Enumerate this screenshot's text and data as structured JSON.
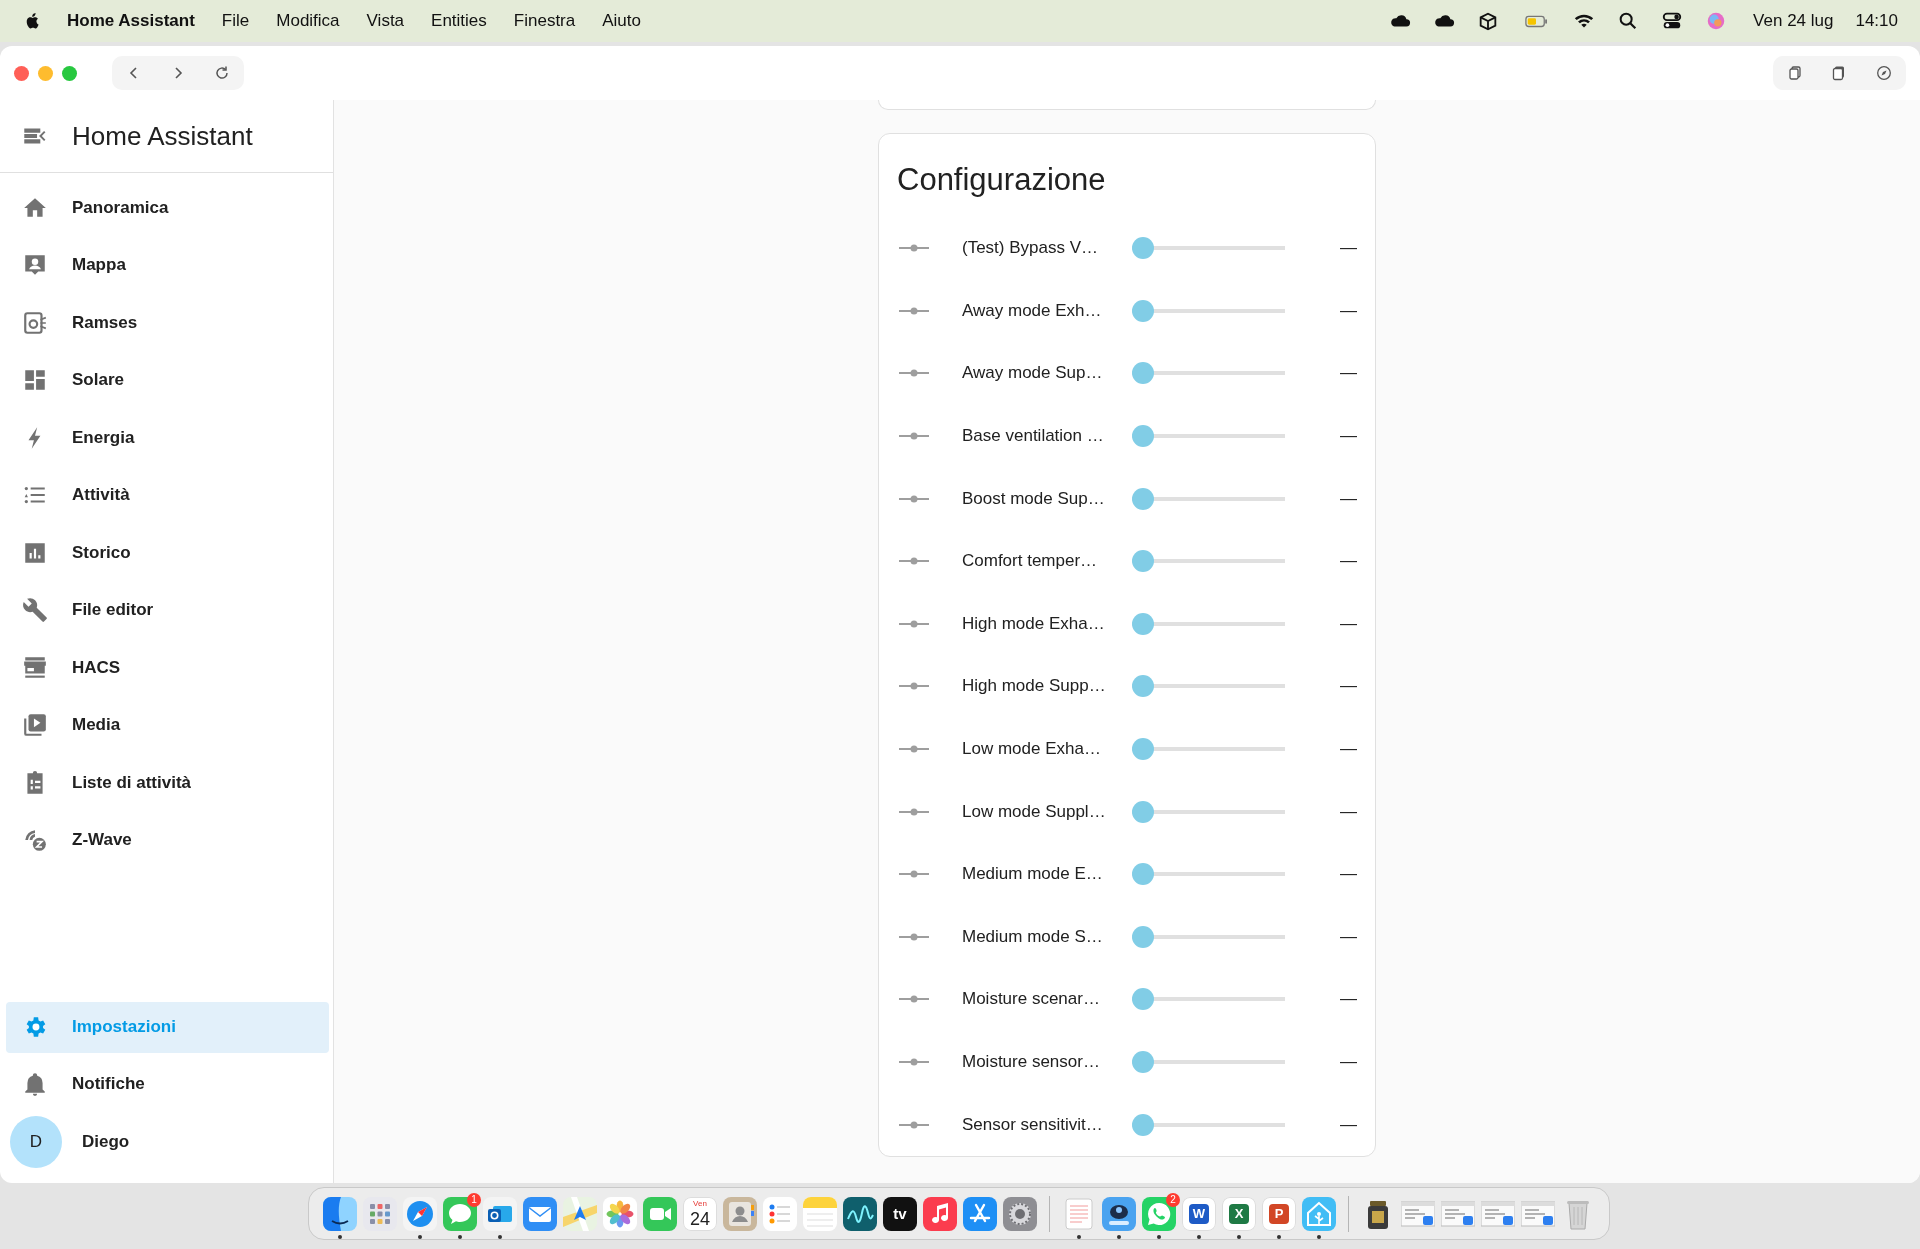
{
  "menu_bar": {
    "app_name": "Home Assistant",
    "menus": [
      "File",
      "Modifica",
      "Vista",
      "Entities",
      "Finestra",
      "Aiuto"
    ],
    "date": "Ven 24 lug",
    "time": "14:10"
  },
  "sidebar": {
    "title": "Home Assistant",
    "items": [
      {
        "label": "Panoramica",
        "kind": "home",
        "selected": false
      },
      {
        "label": "Mappa",
        "kind": "map",
        "selected": false
      },
      {
        "label": "Ramses",
        "kind": "device",
        "selected": false
      },
      {
        "label": "Solare",
        "kind": "dashboard",
        "selected": false
      },
      {
        "label": "Energia",
        "kind": "energy",
        "selected": false
      },
      {
        "label": "Attività",
        "kind": "logbook",
        "selected": false
      },
      {
        "label": "Storico",
        "kind": "history",
        "selected": false
      },
      {
        "label": "File editor",
        "kind": "editor",
        "selected": false
      },
      {
        "label": "HACS",
        "kind": "store",
        "selected": false
      },
      {
        "label": "Media",
        "kind": "media",
        "selected": false
      },
      {
        "label": "Liste di attività",
        "kind": "todo",
        "selected": false
      },
      {
        "label": "Z-Wave",
        "kind": "zwave",
        "selected": false
      }
    ],
    "bottom_items": [
      {
        "label": "Impostazioni",
        "kind": "settings",
        "selected": true
      },
      {
        "label": "Notifiche",
        "kind": "notifications",
        "selected": false
      }
    ],
    "user": {
      "initial": "D",
      "name": "Diego"
    }
  },
  "card": {
    "title": "Configurazione",
    "rows": [
      {
        "name": "(Test) Bypass V…",
        "level": 0,
        "value": "—"
      },
      {
        "name": "Away mode Exh…",
        "level": 0,
        "value": "—"
      },
      {
        "name": "Away mode Sup…",
        "level": 0,
        "value": "—"
      },
      {
        "name": "Base ventilation …",
        "level": 0,
        "value": "—"
      },
      {
        "name": "Boost mode Sup…",
        "level": 0,
        "value": "—"
      },
      {
        "name": "Comfort temper…",
        "level": 0,
        "value": "—"
      },
      {
        "name": "High mode Exha…",
        "level": 0,
        "value": "—"
      },
      {
        "name": "High mode Supp…",
        "level": 0,
        "value": "—"
      },
      {
        "name": "Low mode Exha…",
        "level": 0,
        "value": "—"
      },
      {
        "name": "Low mode Suppl…",
        "level": 0,
        "value": "—"
      },
      {
        "name": "Medium mode E…",
        "level": 0,
        "value": "—"
      },
      {
        "name": "Medium mode S…",
        "level": 0,
        "value": "—"
      },
      {
        "name": "Moisture scenar…",
        "level": 0,
        "value": "—"
      },
      {
        "name": "Moisture sensor…",
        "level": 0,
        "value": "—"
      },
      {
        "name": "Sensor sensitivit…",
        "level": 0,
        "value": "—"
      }
    ]
  },
  "dock": [
    {
      "kind": "finder",
      "running": true
    },
    {
      "kind": "launchpad",
      "running": false
    },
    {
      "kind": "safari",
      "running": true
    },
    {
      "kind": "messages",
      "running": true,
      "badge": "1"
    },
    {
      "kind": "outlook",
      "running": true
    },
    {
      "kind": "mail",
      "running": false
    },
    {
      "kind": "maps",
      "running": false
    },
    {
      "kind": "photos",
      "running": false
    },
    {
      "kind": "facetime",
      "running": false
    },
    {
      "kind": "calendar",
      "running": false,
      "day": "Ven",
      "date": "24"
    },
    {
      "kind": "contacts",
      "running": false
    },
    {
      "kind": "reminders",
      "running": false
    },
    {
      "kind": "notes",
      "running": false
    },
    {
      "kind": "freeform",
      "running": false
    },
    {
      "kind": "tv",
      "running": false,
      "glyph": "tv"
    },
    {
      "kind": "music",
      "running": false
    },
    {
      "kind": "appstore",
      "running": false
    },
    {
      "kind": "settings",
      "running": false
    },
    {
      "kind": "separator"
    },
    {
      "kind": "textedit",
      "running": true
    },
    {
      "kind": "disc",
      "running": true
    },
    {
      "kind": "whatsapp",
      "running": true,
      "badge": "2"
    },
    {
      "kind": "letter",
      "running": true,
      "glyph": "W",
      "color": "#1e5bc6"
    },
    {
      "kind": "letter",
      "running": true,
      "glyph": "X",
      "color": "#1f7a45"
    },
    {
      "kind": "letter",
      "running": true,
      "glyph": "P",
      "color": "#d24726"
    },
    {
      "kind": "house",
      "running": true
    },
    {
      "kind": "separator"
    },
    {
      "kind": "jar"
    },
    {
      "kind": "thumb"
    },
    {
      "kind": "thumb"
    },
    {
      "kind": "thumb"
    },
    {
      "kind": "thumb"
    },
    {
      "kind": "trash"
    }
  ]
}
